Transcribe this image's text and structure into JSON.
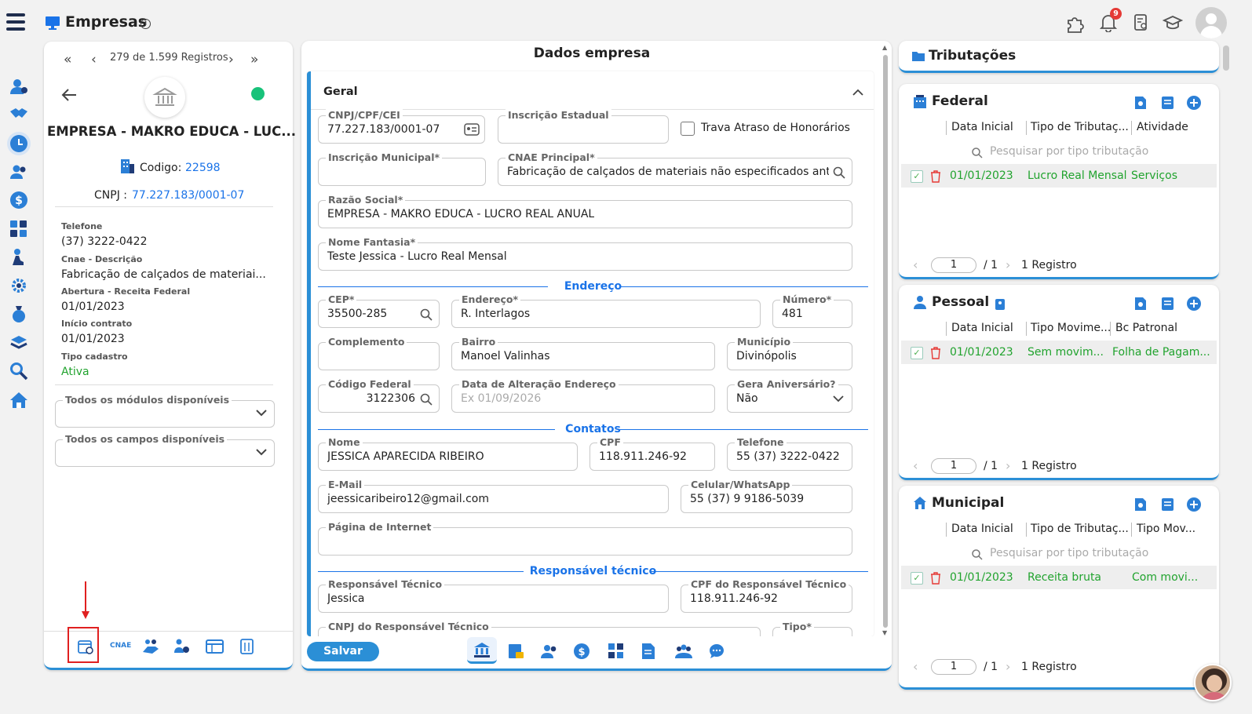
{
  "header": {
    "title": "Empresas",
    "notification_count": "9"
  },
  "left_panel": {
    "nav_label": "279 de 1.599 Registros",
    "company_name": "EMPRESA - MAKRO EDUCA - LUC...",
    "codigo_label": "Codigo:",
    "codigo_value": "22598",
    "cnpj_label": "CNPJ :",
    "cnpj_value": "77.227.183/0001-07",
    "info": [
      {
        "label": "Telefone",
        "value": "(37) 3222-0422"
      },
      {
        "label": "Cnae - Descrição",
        "value": "Fabricação de calçados de materiai..."
      },
      {
        "label": "Abertura - Receita Federal",
        "value": "01/01/2023"
      },
      {
        "label": "Início contrato",
        "value": "01/01/2023"
      },
      {
        "label": "Tipo cadastro",
        "value": "Ativa"
      }
    ],
    "select_modulos": "Todos os módulos disponíveis",
    "select_campos": "Todos os campos disponíveis",
    "cnae_tab": "CNAE"
  },
  "main": {
    "title": "Dados empresa",
    "section_title": "Geral",
    "fields": {
      "cnpj": {
        "label": "CNPJ/CPF/CEI",
        "value": "77.227.183/0001-07"
      },
      "inscricao_estadual": {
        "label": "Inscrição Estadual",
        "value": ""
      },
      "trava": "Trava Atraso de Honorários",
      "inscricao_municipal": {
        "label": "Inscrição Municipal*",
        "value": ""
      },
      "cnae_principal": {
        "label": "CNAE Principal*",
        "value": "Fabricação de calçados de materiais não especificados ant..."
      },
      "razao_social": {
        "label": "Razão Social*",
        "value": "EMPRESA - MAKRO EDUCA - LUCRO REAL ANUAL"
      },
      "nome_fantasia": {
        "label": "Nome Fantasia*",
        "value": "Teste Jessica - Lucro Real Mensal"
      },
      "cep": {
        "label": "CEP*",
        "value": "35500-285"
      },
      "endereco": {
        "label": "Endereço*",
        "value": "R. Interlagos"
      },
      "numero": {
        "label": "Número*",
        "value": "481"
      },
      "complemento": {
        "label": "Complemento",
        "value": ""
      },
      "bairro": {
        "label": "Bairro",
        "value": "Manoel Valinhas"
      },
      "municipio": {
        "label": "Município",
        "value": "Divinópolis"
      },
      "codigo_federal": {
        "label": "Código Federal",
        "value": "3122306"
      },
      "data_alteracao": {
        "label": "Data de Alteração Endereço",
        "placeholder": "Ex 01/09/2026"
      },
      "gera_aniversario": {
        "label": "Gera Aniversário?",
        "value": "Não"
      },
      "nome": {
        "label": "Nome",
        "value": "JESSICA APARECIDA RIBEIRO"
      },
      "cpf": {
        "label": "CPF",
        "value": "118.911.246-92"
      },
      "telefone": {
        "label": "Telefone",
        "value": "55 (37) 3222-0422"
      },
      "email": {
        "label": "E-Mail",
        "value": "jeessicaribeiro12@gmail.com"
      },
      "celular": {
        "label": "Celular/WhatsApp",
        "value": "55 (37) 9 9186-5039"
      },
      "pagina": {
        "label": "Página de Internet",
        "value": ""
      },
      "resp_tecnico": {
        "label": "Responsável Técnico",
        "value": "Jessica"
      },
      "cpf_resp": {
        "label": "CPF do Responsável Técnico",
        "value": "118.911.246-92"
      },
      "cnpj_resp": {
        "label": "CNPJ do Responsável Técnico",
        "value": ""
      },
      "tipo": {
        "label": "Tipo*",
        "value": ""
      }
    },
    "sections": {
      "endereco": "Endereço",
      "contatos": "Contatos",
      "responsavel": "Responsável técnico"
    },
    "save_label": "Salvar"
  },
  "right": {
    "title": "Tributações",
    "federal": {
      "title": "Federal",
      "columns": [
        "Data Inicial",
        "Tipo de Tributaç...",
        "Atividade"
      ],
      "search_placeholder": "Pesquisar por tipo tributação",
      "row": [
        "01/01/2023",
        "Lucro Real Mensal",
        "Serviços"
      ],
      "page": "1",
      "total": "/ 1",
      "records": "1 Registro"
    },
    "pessoal": {
      "title": "Pessoal",
      "columns": [
        "Data Inicial",
        "Tipo Movime...",
        "Bc Patronal"
      ],
      "row": [
        "01/01/2023",
        "Sem movim...",
        "Folha de Pagam..."
      ],
      "page": "1",
      "total": "/ 1",
      "records": "1 Registro"
    },
    "municipal": {
      "title": "Municipal",
      "columns": [
        "Data Inicial",
        "Tipo de Tributaç...",
        "Tipo Mov..."
      ],
      "search_placeholder": "Pesquisar por tipo tributação",
      "row": [
        "01/01/2023",
        "Receita bruta",
        "Com movi..."
      ],
      "page": "1",
      "total": "/ 1",
      "records": "1 Registro"
    }
  },
  "colors": {
    "accent": "#1a73e8",
    "navy": "#1f3c78",
    "green": "#21a32e",
    "red": "#e53935"
  }
}
